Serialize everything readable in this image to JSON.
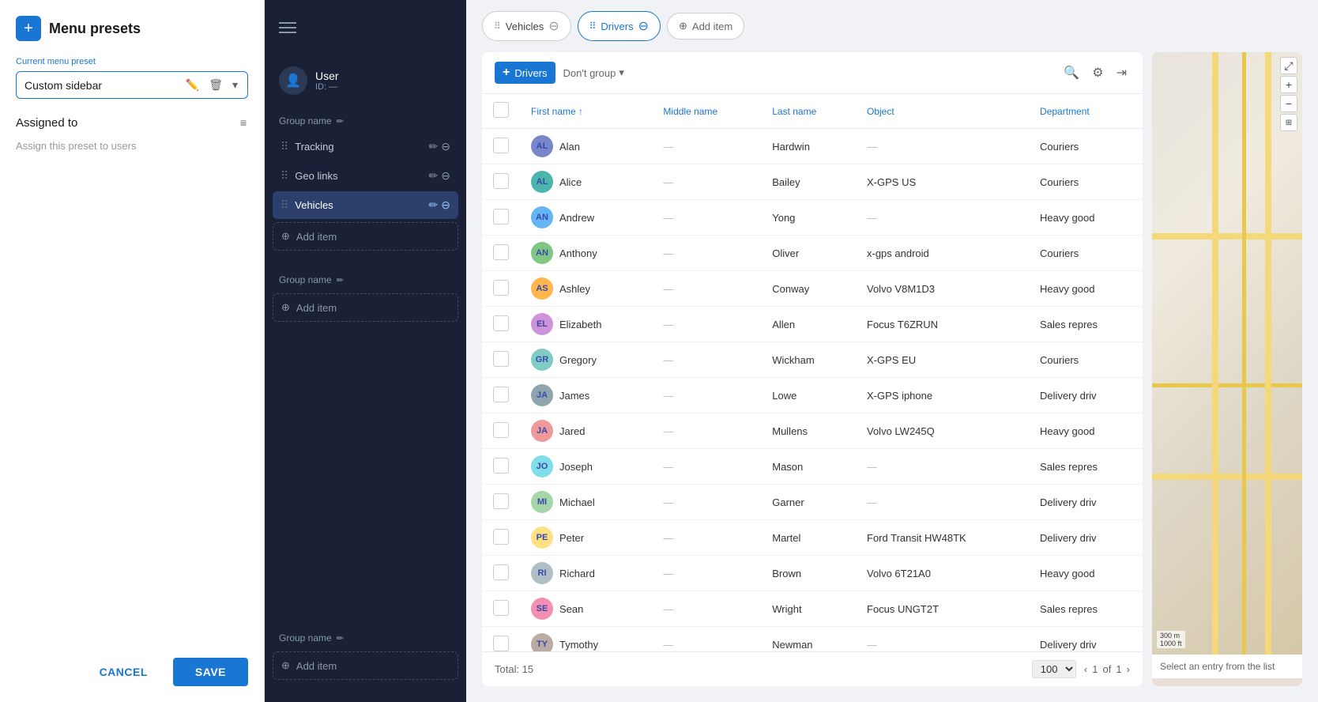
{
  "app": {
    "title": "Menu presets",
    "add_icon": "+"
  },
  "left_panel": {
    "preset_label": "Current menu preset",
    "preset_name": "Custom sidebar",
    "assigned_label": "Assigned to",
    "assign_users_text": "Assign this preset to users"
  },
  "dark_sidebar": {
    "hamburger": true,
    "user": {
      "name": "User",
      "id": "ID: —"
    },
    "groups": [
      {
        "id": "group1",
        "label": "Group name",
        "items": [
          {
            "id": "tracking",
            "label": "Tracking"
          },
          {
            "id": "geo-links",
            "label": "Geo links"
          },
          {
            "id": "vehicles",
            "label": "Vehicles",
            "active": true
          }
        ],
        "add_item_label": "Add item"
      },
      {
        "id": "group2",
        "label": "Group name",
        "items": [],
        "add_item_label": "Add item"
      },
      {
        "id": "group3",
        "label": "Group name",
        "items": [],
        "add_item_label": "Add item"
      }
    ]
  },
  "top_bar": {
    "tabs": [
      {
        "id": "vehicles",
        "label": "Vehicles",
        "active": false
      },
      {
        "id": "drivers",
        "label": "Drivers",
        "active": true
      }
    ],
    "add_tab_label": "Add item"
  },
  "drivers_panel": {
    "title": "Drivers",
    "group_label": "Don't group",
    "group_arrow": "▾",
    "columns": [
      {
        "id": "first_name",
        "label": "First name ↑"
      },
      {
        "id": "middle_name",
        "label": "Middle name"
      },
      {
        "id": "last_name",
        "label": "Last name"
      },
      {
        "id": "object",
        "label": "Object"
      },
      {
        "id": "department",
        "label": "Department"
      }
    ],
    "rows": [
      {
        "first_name": "Alan",
        "middle_name": "—",
        "last_name": "Hardwin",
        "object": "—",
        "department": "Couriers",
        "avatar": "AL",
        "color": "#7986cb"
      },
      {
        "first_name": "Alice",
        "middle_name": "—",
        "last_name": "Bailey",
        "object": "X-GPS US",
        "department": "Couriers",
        "avatar": "AL",
        "color": "#4db6ac"
      },
      {
        "first_name": "Andrew",
        "middle_name": "—",
        "last_name": "Yong",
        "object": "—",
        "department": "Heavy good",
        "avatar": "AN",
        "color": "#64b5f6"
      },
      {
        "first_name": "Anthony",
        "middle_name": "—",
        "last_name": "Oliver",
        "object": "x-gps android",
        "department": "Couriers",
        "avatar": "AN",
        "color": "#81c784"
      },
      {
        "first_name": "Ashley",
        "middle_name": "—",
        "last_name": "Conway",
        "object": "Volvo V8M1D3",
        "department": "Heavy good",
        "avatar": "AS",
        "color": "#ffb74d"
      },
      {
        "first_name": "Elizabeth",
        "middle_name": "—",
        "last_name": "Allen",
        "object": "Focus T6ZRUN",
        "department": "Sales repres",
        "avatar": "EL",
        "color": "#ce93d8"
      },
      {
        "first_name": "Gregory",
        "middle_name": "—",
        "last_name": "Wickham",
        "object": "X-GPS EU",
        "department": "Couriers",
        "avatar": "GR",
        "color": "#80cbc4"
      },
      {
        "first_name": "James",
        "middle_name": "—",
        "last_name": "Lowe",
        "object": "X-GPS iphone",
        "department": "Delivery driv",
        "avatar": "JA",
        "color": "#90a4ae"
      },
      {
        "first_name": "Jared",
        "middle_name": "—",
        "last_name": "Mullens",
        "object": "Volvo LW245Q",
        "department": "Heavy good",
        "avatar": "JA",
        "color": "#ef9a9a"
      },
      {
        "first_name": "Joseph",
        "middle_name": "—",
        "last_name": "Mason",
        "object": "—",
        "department": "Sales repres",
        "avatar": "JO",
        "color": "#80deea"
      },
      {
        "first_name": "Michael",
        "middle_name": "—",
        "last_name": "Garner",
        "object": "—",
        "department": "Delivery driv",
        "avatar": "MI",
        "color": "#a5d6a7"
      },
      {
        "first_name": "Peter",
        "middle_name": "—",
        "last_name": "Martel",
        "object": "Ford Transit HW48TK",
        "department": "Delivery driv",
        "avatar": "PE",
        "color": "#ffe082"
      },
      {
        "first_name": "Richard",
        "middle_name": "—",
        "last_name": "Brown",
        "object": "Volvo 6T21A0",
        "department": "Heavy good",
        "avatar": "RI",
        "color": "#b0bec5"
      },
      {
        "first_name": "Sean",
        "middle_name": "—",
        "last_name": "Wright",
        "object": "Focus UNGT2T",
        "department": "Sales repres",
        "avatar": "SE",
        "color": "#f48fb1"
      },
      {
        "first_name": "Tymothy",
        "middle_name": "—",
        "last_name": "Newman",
        "object": "—",
        "department": "Delivery driv",
        "avatar": "TY",
        "color": "#bcaaa4"
      }
    ],
    "footer": {
      "total_label": "Total: 15",
      "page_size": "100",
      "page_current": "1",
      "page_total": "1"
    }
  },
  "map": {
    "select_text": "Select an entry from the list"
  },
  "actions": {
    "cancel_label": "CANCEL",
    "save_label": "SAVE"
  }
}
